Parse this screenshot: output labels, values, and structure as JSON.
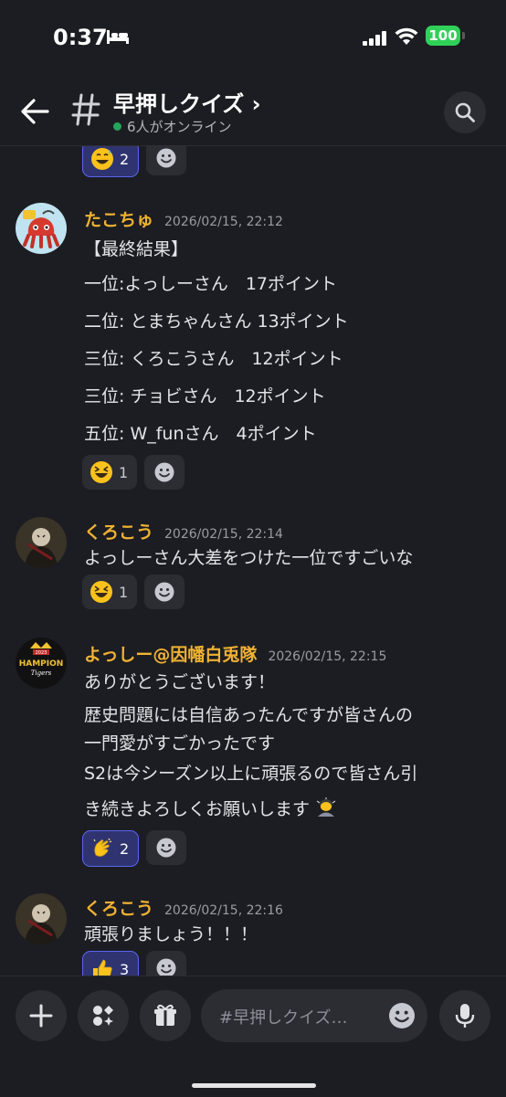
{
  "status": {
    "time": "0:37",
    "battery": "100"
  },
  "header": {
    "title": "早押しクイズ ›",
    "online": "6人がオンライン"
  },
  "top_reactions": [
    {
      "count": "2",
      "mine": true
    }
  ],
  "messages": [
    {
      "author": "たこちゅ",
      "timestamp": "2026/02/15, 22:12",
      "lines": [
        "【最終結果】",
        "一位:よっしーさん　17ポイント",
        "二位: とまちゃんさん 13ポイント",
        "三位: くろこうさん　12ポイント",
        "三位: チョビさん　12ポイント",
        "五位: W_funさん　4ポイント"
      ],
      "reactions": [
        {
          "count": "1",
          "mine": false
        }
      ]
    },
    {
      "author": "くろこう",
      "timestamp": "2026/02/15, 22:14",
      "lines": [
        "よっしーさん大差をつけた一位ですごいな"
      ],
      "reactions": [
        {
          "count": "1",
          "mine": false
        }
      ]
    },
    {
      "author": "よっしー@因幡白兎隊",
      "timestamp": "2026/02/15, 22:15",
      "lines": [
        "ありがとうございます！",
        "歴史問題には自信あったんですが皆さんの",
        "一門愛がすごかったです",
        "S2は今シーズン以上に頑張るので皆さん引",
        "き続きよろしくお願いします"
      ],
      "reactions": [
        {
          "count": "2",
          "mine": true
        }
      ]
    },
    {
      "author": "くろこう",
      "timestamp": "2026/02/15, 22:16",
      "lines": [
        "頑張りましょう！！！"
      ],
      "reactions": [
        {
          "count": "3",
          "mine": true
        }
      ]
    }
  ],
  "composer": {
    "placeholder": "#早押しクイズ…"
  },
  "avatar_logo": {
    "year": "2023",
    "word": "HAMPION",
    "sub": "Tigers"
  },
  "colors": {
    "background": "#1c1d22",
    "author": "#f0b232",
    "accent": "#5865f2"
  }
}
